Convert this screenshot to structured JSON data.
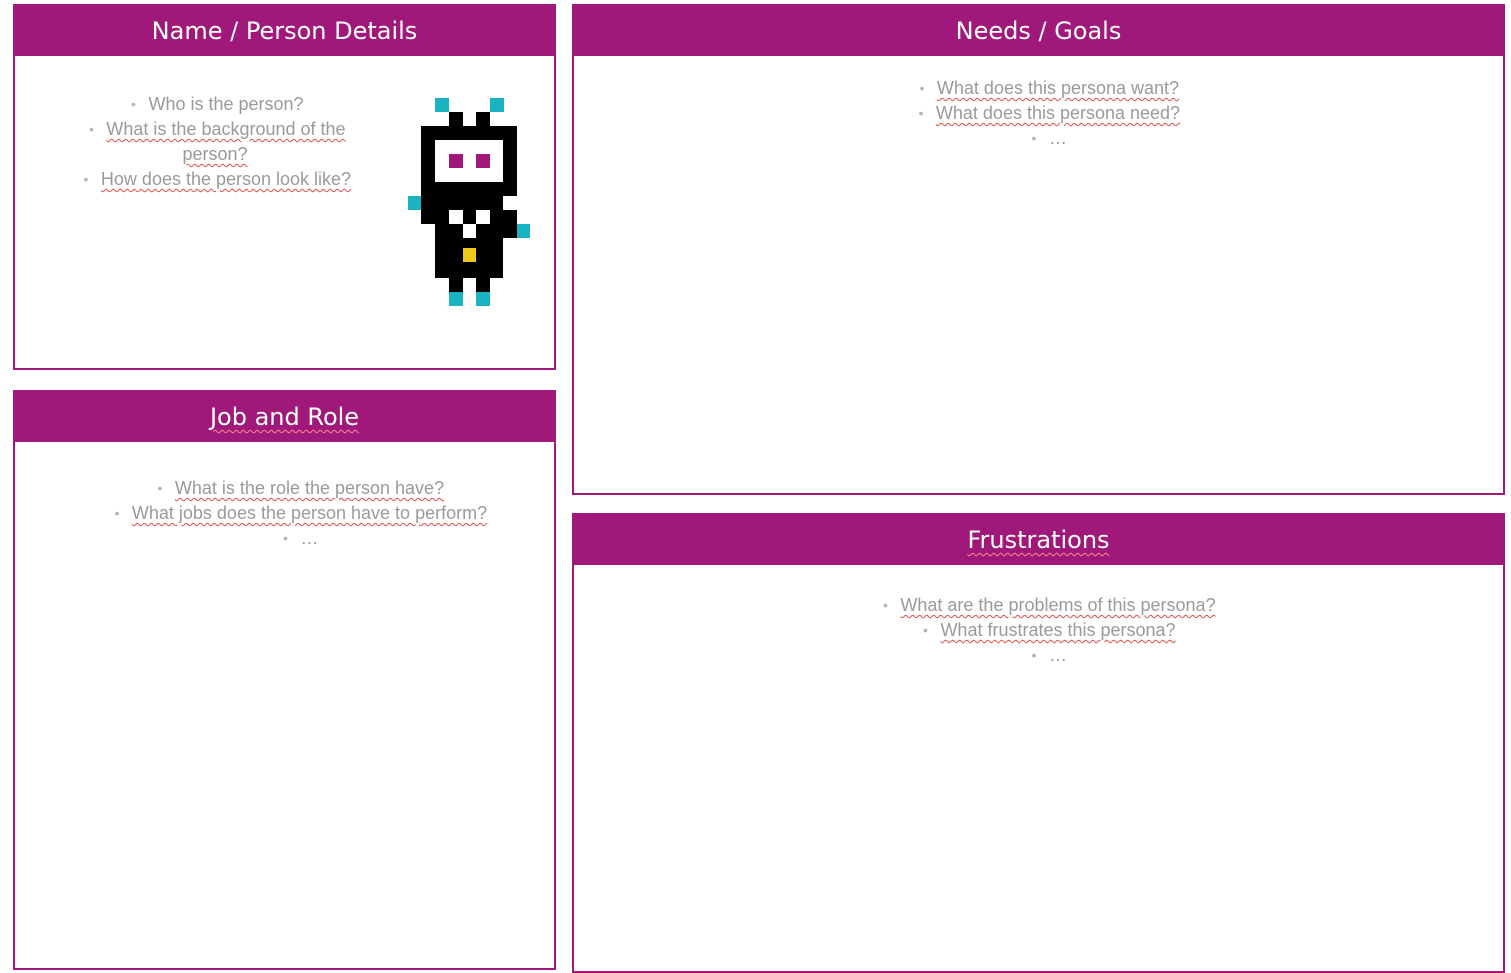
{
  "colors": {
    "header_bg": "#a0197a",
    "header_text": "#ffffff",
    "bullet_text": "#9a9a9a",
    "spellcheck_underline": "#e14b4b"
  },
  "panels": {
    "name": {
      "title": "Name / Person Details",
      "bullets": [
        "Who is the person?",
        "What is the background of the person?",
        "How does the person look like?"
      ],
      "avatar_icon": "pixel-robot-icon"
    },
    "job": {
      "title": "Job and Role",
      "bullets": [
        "What is the role the person have?",
        "What jobs does the person have to perform?",
        "…"
      ]
    },
    "needs": {
      "title": "Needs / Goals",
      "bullets": [
        "What does this persona want?",
        "What does this persona need?",
        "…"
      ]
    },
    "frustrations": {
      "title": "Frustrations",
      "bullets": [
        "What are the problems of this persona?",
        "What frustrates this persona?",
        "…"
      ]
    }
  }
}
